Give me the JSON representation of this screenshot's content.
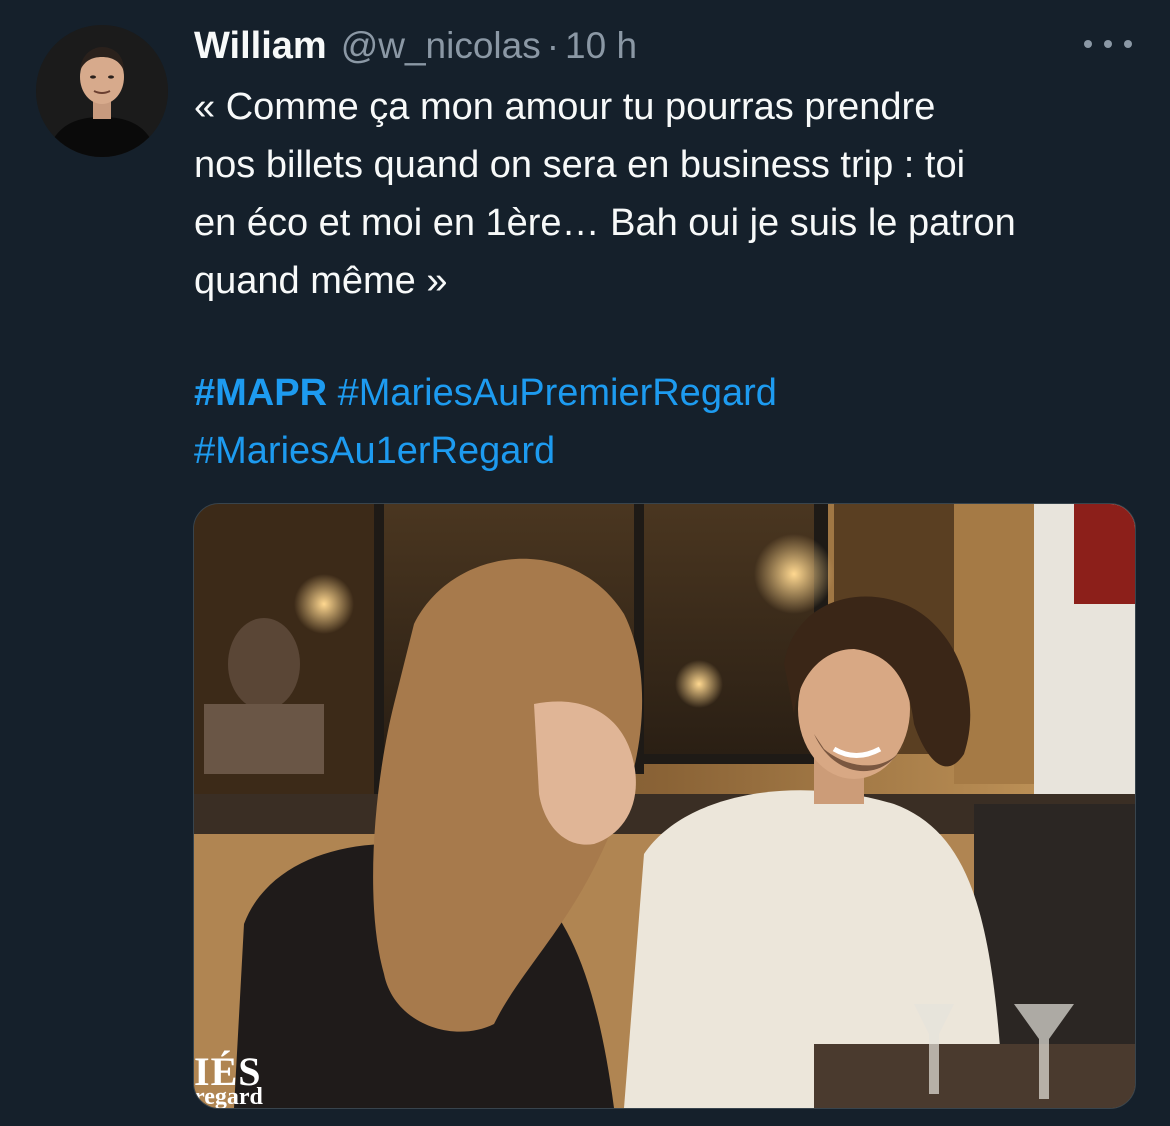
{
  "author": {
    "display_name": "William",
    "handle": "@w_nicolas",
    "separator": "·",
    "time": "10 h",
    "avatar_icon": "profile-photo"
  },
  "more_icon": "more-horizontal-icon",
  "tweet": {
    "text_lines": [
      "« Comme ça mon amour tu pourras prendre",
      "nos billets quand on sera en business trip : toi",
      "en éco et moi en 1ère… Bah oui je suis le patron",
      "quand même »"
    ],
    "hashtags": {
      "first": "#MAPR",
      "second": "#MariesAuPremierRegard",
      "third": "#MariesAu1erRegard"
    }
  },
  "media": {
    "watermark_main": "IÉS",
    "watermark_sub": "regard"
  },
  "colors": {
    "background": "#15202b",
    "text": "#f7f9f9",
    "secondary": "#8b98a5",
    "link": "#1d9bf0"
  }
}
